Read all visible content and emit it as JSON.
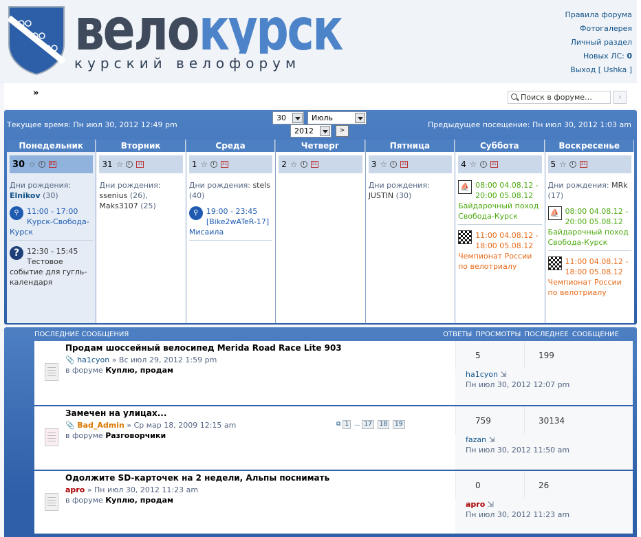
{
  "header": {
    "logo_word": "велокурск",
    "logo_sub": "курский велофорум",
    "links": [
      "Правила форума",
      "Фотогалерея",
      "Личный раздел"
    ],
    "pm_label": "Новых ЛС:",
    "pm_count": "0",
    "logout": "Выход [ Ushka ]"
  },
  "nav": {
    "arrow": "»",
    "search_placeholder": "Поиск в форуме…",
    "search_btn": "›"
  },
  "calendar": {
    "current_time": "Текущее время: Пн июл 30, 2012 12:49 pm",
    "prev_visit": "Предыдущее посещение: Пн июл 30, 2012 1:03 am",
    "sel_day": "30",
    "sel_month": "Июль",
    "sel_year": "2012",
    "go_btn": ">",
    "weekdays": [
      "Понедельник",
      "Вторник",
      "Среда",
      "Четверг",
      "Пятница",
      "Суббота",
      "Воскресенье"
    ],
    "days": [
      "30",
      "31",
      "1",
      "2",
      "3",
      "4",
      "5"
    ],
    "bday_label": "Дни рождения:",
    "mon": {
      "bday_name": "Elnikov",
      "bday_age": "(30)",
      "ev1_time": "11:00 - 17:00",
      "ev1_title": "Курск-Свобода-Курск",
      "ev2_time": "12:30 - 15:45",
      "ev2_title": "Тестовое событие для гугль-календаря"
    },
    "tue": {
      "bday1": "ssenius",
      "bday1_age": "(26),",
      "bday2": "Maks3107",
      "bday2_age": "(25)"
    },
    "wed": {
      "bday_name": "stels",
      "bday_age": "(40)",
      "ev_time": "19:00 - 23:45",
      "ev_title": "[Bike2wATeR-17] Мисаила"
    },
    "fri": {
      "bday_name": "JUSTIN",
      "bday_age": "(30)"
    },
    "sat": {
      "ev1_time": "08:00 04.08.12 - 20:00 05.08.12",
      "ev1_title": "Байдарочный поход Свобода-Курск",
      "ev2_time": "11:00 04.08.12 - 18:00 05.08.12",
      "ev2_title": "Чемпионат России по велотриалу"
    },
    "sun": {
      "bday_name": "MRk",
      "bday_age": "(17)",
      "ev1_time": "08:00 04.08.12 - 20:00 05.08.12",
      "ev1_title": "Байдарочный поход Свобода-Курск",
      "ev2_time": "11:00 04.08.12 - 18:00 05.08.12",
      "ev2_title": "Чемпионат России по велотриалу"
    }
  },
  "recent": {
    "heading": "ПОСЛЕДНИЕ СООБЩЕНИЯ",
    "columns": "ОТВЕТЫ  ПРОСМОТРЫ  ПОСЛЕДНЕЕ СООБЩЕНИЕ",
    "in_forum": "в форуме",
    "topics": [
      {
        "title": "Продам шоссейный велосипед Merida Road Race Lite 903",
        "author": "ha1cyon",
        "date": "» Вс июл 29, 2012 1:59 pm",
        "forum": "Куплю, продам",
        "replies": "5",
        "views": "199",
        "last_user": "ha1cyon",
        "last_date": "Пн июл 30, 2012 12:07 pm"
      },
      {
        "title": "Замечен на улицах...",
        "author": "Bad_Admin",
        "date": "» Ср мар 18, 2009 12:15 am",
        "forum": "Разговорчики",
        "replies": "759",
        "views": "30134",
        "last_user": "fazan",
        "last_date": "Пн июл 30, 2012 11:50 am",
        "pages": [
          "1",
          "...",
          "17",
          "18",
          "19"
        ]
      },
      {
        "title": "Одолжите SD-карточек на 2 недели, Альпы поснимать",
        "author": "apro",
        "date": "» Пн июл 30, 2012 11:23 am",
        "forum": "Куплю, продам",
        "replies": "0",
        "views": "26",
        "last_user": "apro",
        "last_date": "Пн июл 30, 2012 11:23 am"
      }
    ]
  },
  "colors": {
    "accent": "#4d7fc3",
    "link": "#105289",
    "green": "#4ca90f",
    "orange": "#e76b1a",
    "author_orange": "#d97700",
    "author_red": "#aa0000"
  }
}
